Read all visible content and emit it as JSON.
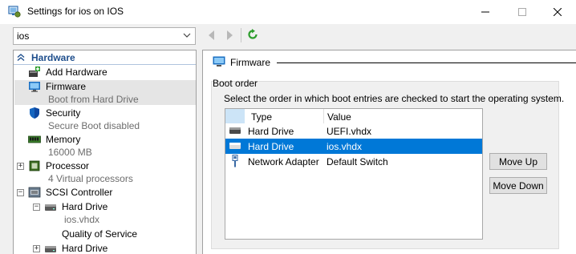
{
  "window": {
    "title": "Settings for ios on IOS"
  },
  "toolbar": {
    "vm_selected": "ios"
  },
  "tree": {
    "header": "Hardware",
    "items": [
      {
        "label": "Add Hardware"
      },
      {
        "label": "Firmware",
        "sub": "Boot from Hard Drive"
      },
      {
        "label": "Security",
        "sub": "Secure Boot disabled"
      },
      {
        "label": "Memory",
        "sub": "16000 MB"
      },
      {
        "label": "Processor",
        "sub": "4 Virtual processors"
      },
      {
        "label": "SCSI Controller"
      },
      {
        "label": "Hard Drive",
        "sub": "ios.vhdx"
      },
      {
        "label": "Quality of Service"
      },
      {
        "label": "Hard Drive"
      }
    ]
  },
  "firmware": {
    "section_title": "Firmware",
    "group_title": "Boot order",
    "description": "Select the order in which boot entries are checked to start the operating system.",
    "columns": [
      "Type",
      "Value"
    ],
    "rows": [
      {
        "type": "Hard Drive",
        "value": "UEFI.vhdx",
        "icon": "hard-drive-icon",
        "selected": false
      },
      {
        "type": "Hard Drive",
        "value": "ios.vhdx",
        "icon": "hard-drive-icon",
        "selected": true
      },
      {
        "type": "Network Adapter",
        "value": "Default Switch",
        "icon": "network-adapter-icon",
        "selected": false
      }
    ],
    "move_up": "Move Up",
    "move_down": "Move Down"
  },
  "colors": {
    "selection": "#0078d7",
    "header_text": "#1e4e8c",
    "refresh": "#2e9e2e"
  }
}
